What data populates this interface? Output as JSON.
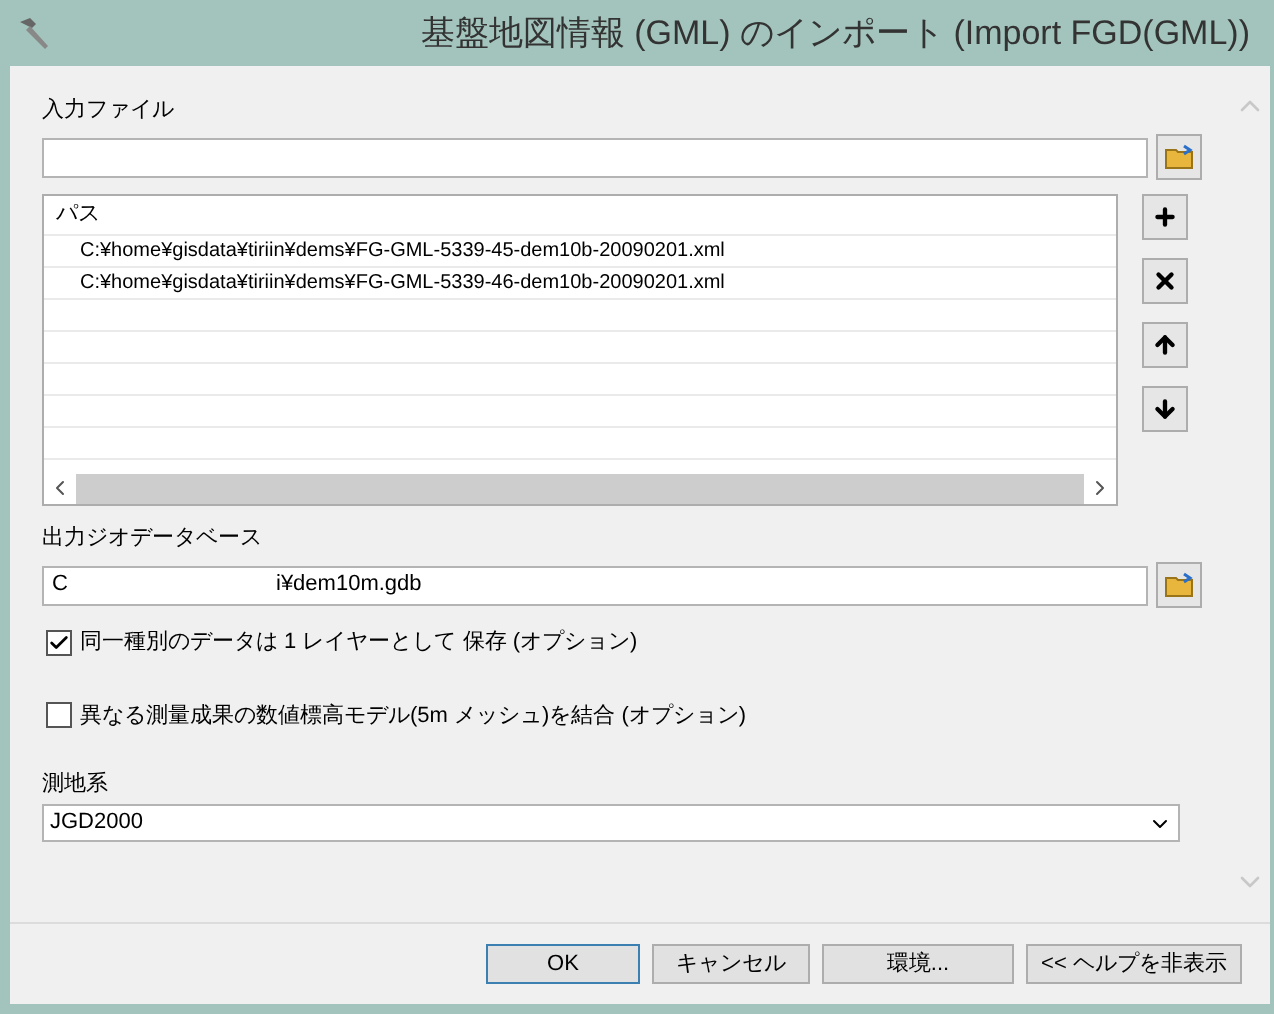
{
  "window": {
    "title": "基盤地図情報 (GML) のインポート (Import FGD(GML))"
  },
  "input_files": {
    "label": "入力ファイル",
    "list": {
      "header": "パス",
      "rows": [
        "C:¥home¥gisdata¥tiriin¥dems¥FG-GML-5339-45-dem10b-20090201.xml",
        "C:¥home¥gisdata¥tiriin¥dems¥FG-GML-5339-46-dem10b-20090201.xml"
      ]
    }
  },
  "output_gdb": {
    "label": "出力ジオデータベース",
    "value_start": "C",
    "value_end": "i¥dem10m.gdb"
  },
  "options": [
    {
      "label": "同一種別のデータは 1 レイヤーとして 保存 (オプション)",
      "checked": true
    },
    {
      "label": "異なる測量成果の数値標高モデル(5m メッシュ)を結合 (オプション)",
      "checked": false
    }
  ],
  "datum": {
    "label": "測地系",
    "value": "JGD2000"
  },
  "buttons": [
    {
      "label": "OK",
      "selected": true
    },
    {
      "label": "キャンセル",
      "selected": false
    },
    {
      "label": "環境...",
      "selected": false
    },
    {
      "label": "<< ヘルプを非表示",
      "selected": false
    }
  ]
}
